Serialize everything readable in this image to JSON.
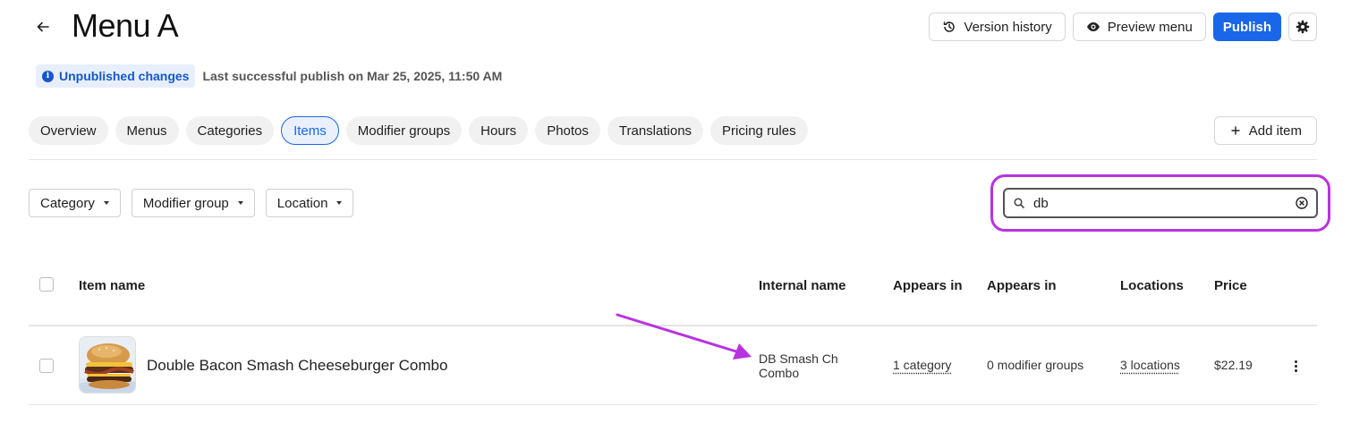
{
  "header": {
    "title": "Menu A",
    "version_history_label": "Version history",
    "preview_label": "Preview menu",
    "publish_label": "Publish"
  },
  "status": {
    "badge": "Unpublished changes",
    "last_publish": "Last successful publish on Mar 25, 2025, 11:50 AM"
  },
  "tabs": [
    {
      "label": "Overview",
      "active": false
    },
    {
      "label": "Menus",
      "active": false
    },
    {
      "label": "Categories",
      "active": false
    },
    {
      "label": "Items",
      "active": true
    },
    {
      "label": "Modifier groups",
      "active": false
    },
    {
      "label": "Hours",
      "active": false
    },
    {
      "label": "Photos",
      "active": false
    },
    {
      "label": "Translations",
      "active": false
    },
    {
      "label": "Pricing rules",
      "active": false
    }
  ],
  "add_item_label": "Add item",
  "filters": {
    "category": "Category",
    "modifier_group": "Modifier group",
    "location": "Location"
  },
  "search": {
    "value": "db"
  },
  "table": {
    "columns": [
      "Item name",
      "Internal name",
      "Appears in",
      "Appears in",
      "Locations",
      "Price"
    ],
    "rows": [
      {
        "item_name": "Double Bacon Smash Cheeseburger Combo",
        "internal_name": "DB Smash Ch Combo",
        "categories": "1 category",
        "modifier_groups": "0 modifier groups",
        "locations": "3 locations",
        "price": "$22.19"
      }
    ]
  },
  "colors": {
    "primary": "#1a66e8",
    "highlight": "#b832e0"
  }
}
